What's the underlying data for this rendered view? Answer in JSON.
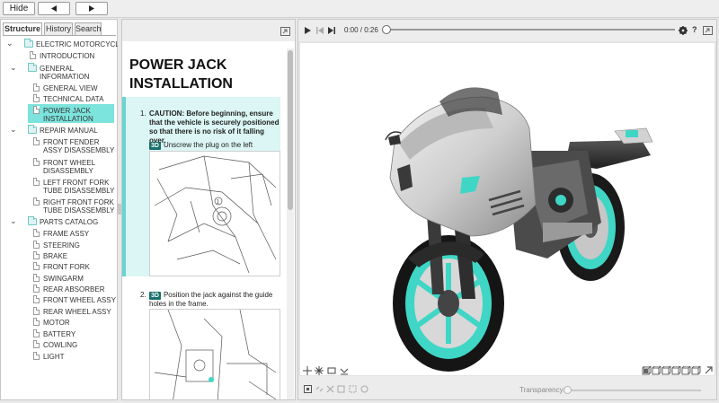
{
  "toolbar": {
    "hide_label": "Hide",
    "back_icon": "triangle-left-icon",
    "forward_icon": "triangle-right-icon"
  },
  "tabs": [
    {
      "label": "Structure",
      "active": true
    },
    {
      "label": "History",
      "active": false
    },
    {
      "label": "Search",
      "active": false
    }
  ],
  "tree": {
    "root": "ELECTRIC MOTORCYCLE",
    "introduction": "INTRODUCTION",
    "general_information": "GENERAL INFORMATION",
    "general_view": "GENERAL VIEW",
    "technical_data": "TECHNICAL DATA",
    "power_jack": "POWER JACK INSTALLATION",
    "repair_manual": "REPAIR MANUAL",
    "front_fender": "FRONT FENDER ASSY DISASSEMBLY",
    "front_wheel": "FRONT WHEEL DISASSEMBLY",
    "left_fork": "LEFT FRONT FORK TUBE DISASSEMBLY",
    "right_fork": "RIGHT FRONT FORK TUBE DISASSEMBLY",
    "parts_catalog": "PARTS CATALOG",
    "parts": [
      "FRAME ASSY",
      "STEERING",
      "BRAKE",
      "FRONT FORK",
      "SWINGARM",
      "REAR ABSORBER",
      "FRONT WHEEL ASSY",
      "REAR WHEEL ASSY",
      "MOTOR",
      "BATTERY",
      "COWLING",
      "LIGHT"
    ]
  },
  "document": {
    "title": "POWER JACK INSTALLATION",
    "step1_number": "1.",
    "step1_caution": "CAUTION: Before beginning, ensure that the vehicle is securely positioned so that there is no risk of it falling over.",
    "badge": "3D",
    "step1_instruction": "Unscrew the plug on the left cowling.",
    "callout": "1",
    "step2_number": "2.",
    "step2_instruction": "Position the jack against the guide holes in the frame."
  },
  "player": {
    "time": "0:00 / 0:26",
    "progress": 0.0
  },
  "viewer": {
    "transparency_label": "Transparency:",
    "accent_color": "#3fd6c6"
  },
  "colors": {
    "selection": "#7de3dd",
    "step_highlight": "#dbf6f4",
    "badge": "#17706b"
  }
}
